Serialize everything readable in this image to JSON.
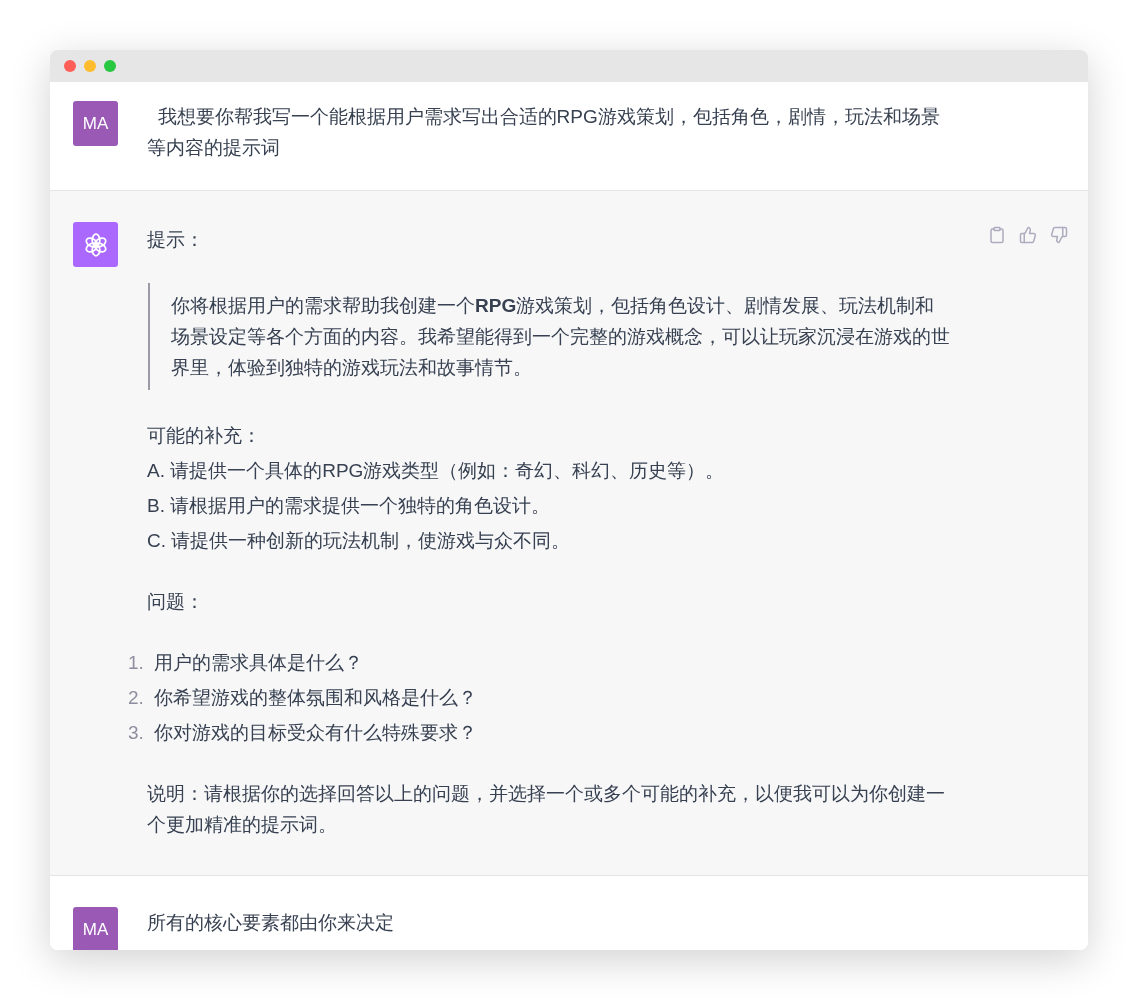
{
  "window": {
    "traffic_lights": [
      {
        "color": "#ff5f57"
      },
      {
        "color": "#febc2e"
      },
      {
        "color": "#28c840"
      }
    ]
  },
  "messages": [
    {
      "kind": "user",
      "avatar": "MA",
      "text": "  我想要你帮我写一个能根据用户需求写出合适的RPG游戏策划，包括角色，剧情，玩法和场景等内容的提示词"
    },
    {
      "kind": "assistant",
      "blocks": [
        {
          "kind": "paragraph",
          "text": "提示："
        },
        {
          "kind": "quote",
          "text": "你将根据用户的需求帮助我创建一个**RPG**游戏策划，包括角色设计、剧情发展、玩法机制和场景设定等各个方面的内容。我希望能得到一个完整的游戏概念，可以让玩家沉浸在游戏的世界里，体验到独特的游戏玩法和故事情节。"
        },
        {
          "kind": "lines",
          "lines": [
            "可能的补充：",
            "A. 请提供一个具体的RPG游戏类型（例如：奇幻、科幻、历史等）。",
            "B. 请根据用户的需求提供一个独特的角色设计。",
            "C. 请提供一种创新的玩法机制，使游戏与众不同。"
          ]
        },
        {
          "kind": "paragraph",
          "text": "问题："
        },
        {
          "kind": "ordered_list",
          "items": [
            {
              "number": "1.",
              "text": "用户的需求具体是什么？"
            },
            {
              "number": "2.",
              "text": "你希望游戏的整体氛围和风格是什么？"
            },
            {
              "number": "3.",
              "text": "你对游戏的目标受众有什么特殊要求？"
            }
          ]
        },
        {
          "kind": "paragraph",
          "text": "说明：请根据你的选择回答以上的问题，并选择一个或多个可能的补充，以便我可以为你创建一个更加精准的提示词。"
        }
      ]
    },
    {
      "kind": "user",
      "avatar": "MA",
      "text": "所有的核心要素都由你来决定"
    }
  ]
}
